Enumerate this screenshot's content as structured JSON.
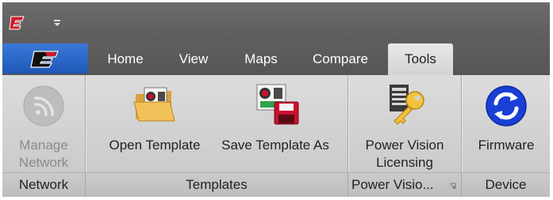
{
  "tabs": [
    "Home",
    "View",
    "Maps",
    "Compare",
    "Tools"
  ],
  "active_tab": "Tools",
  "groups": {
    "network": {
      "label": "Network",
      "buttons": {
        "manage_network": {
          "line1": "Manage",
          "line2": "Network",
          "icon": "wifi-icon",
          "disabled": true
        }
      }
    },
    "templates": {
      "label": "Templates",
      "buttons": {
        "open_template": {
          "label": "Open Template",
          "icon": "folder-open-icon"
        },
        "save_template_as": {
          "label": "Save Template As",
          "icon": "save-as-icon"
        }
      }
    },
    "power_vision": {
      "label": "Power Visio...",
      "buttons": {
        "licensing": {
          "line1": "Power Vision",
          "line2": "Licensing",
          "icon": "key-icon"
        }
      }
    },
    "device": {
      "label": "Device",
      "buttons": {
        "firmware": {
          "label": "Firmware",
          "icon": "refresh-icon"
        }
      }
    }
  },
  "colors": {
    "file_tab": "#2a66c9",
    "title_bar": "#5f5f5f",
    "ribbon": "#d2d2d2",
    "brand_red": "#c8102e",
    "firmware_blue": "#1a3fd6"
  }
}
